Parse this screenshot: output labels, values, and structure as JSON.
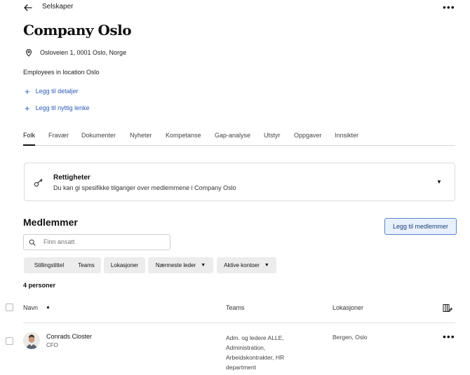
{
  "topbar": {
    "back_icon": "arrow-left-icon",
    "title": "Selskaper",
    "more_icon": "more-horizontal-icon",
    "more_glyph": "•••"
  },
  "page": {
    "title": "Company Oslo",
    "address_icon": "location-pin-icon",
    "address": "Osloveien 1, 0001 Oslo, Norge",
    "description": "Employees in location Oslo",
    "add_details": "Legg til detaljer",
    "add_link": "Legg til nyttig lenke"
  },
  "tabs": [
    {
      "label": "Folk",
      "active": true
    },
    {
      "label": "Fravær",
      "active": false
    },
    {
      "label": "Dokumenter",
      "active": false
    },
    {
      "label": "Nyheter",
      "active": false
    },
    {
      "label": "Kompetanse",
      "active": false
    },
    {
      "label": "Gap-analyse",
      "active": false
    },
    {
      "label": "Utstyr",
      "active": false
    },
    {
      "label": "Oppgaver",
      "active": false
    },
    {
      "label": "Innsikter",
      "active": false
    }
  ],
  "rights": {
    "icon": "key-icon",
    "title": "Rettigheter",
    "subtitle": "Du kan gi spesifikke tilganger over medlemmene i Company Oslo"
  },
  "members": {
    "title": "Medlemmer",
    "add_button": "Legg til medlemmer",
    "search_placeholder": "Finn ansatt",
    "filters": [
      {
        "label": "Stillingstittel",
        "dropdown": false
      },
      {
        "label": "Teams",
        "dropdown": false
      },
      {
        "label": "Lokasjoner",
        "dropdown": false
      },
      {
        "label": "Nærmeste leder",
        "dropdown": true
      },
      {
        "label": "Aktive kontoer",
        "dropdown": true
      }
    ],
    "count": "4 personer",
    "columns": {
      "name": "Navn",
      "teams": "Teams",
      "locations": "Lokasjoner"
    },
    "rows": [
      {
        "name": "Conrads Closter",
        "role": "CFO",
        "teams": "Adm. og ledere ALLE, Administration, Arbeidskontrakter, HR department",
        "locations": "Bergen, Oslo"
      }
    ]
  },
  "colors": {
    "accent": "#2e5cb8",
    "button_bg": "#e8f0fb",
    "chip_bg": "#ececec"
  }
}
